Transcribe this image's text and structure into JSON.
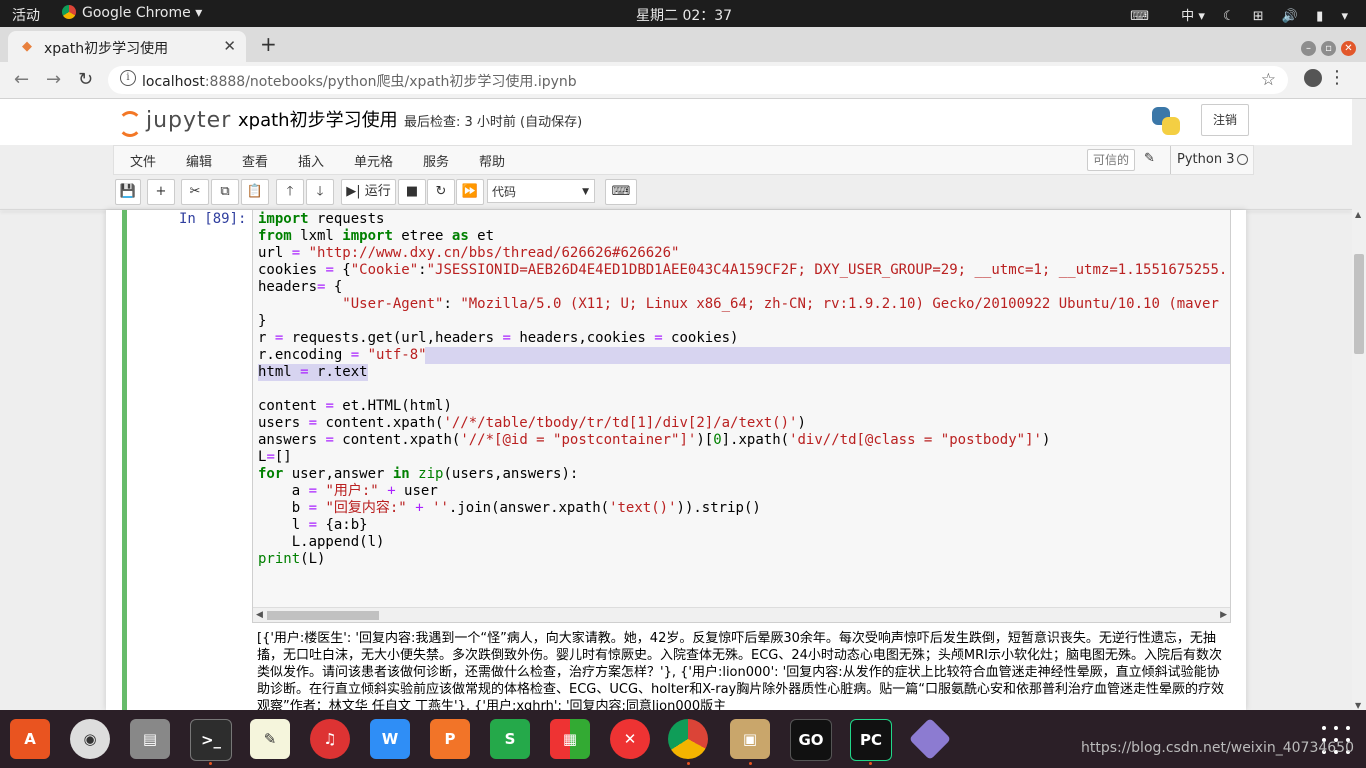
{
  "system": {
    "activities": "活动",
    "app_name": "Google Chrome",
    "clock": "星期二 02：37",
    "input_method": "中"
  },
  "browser": {
    "tab_title": "xpath初步学习使用",
    "url_host": "localhost",
    "url_rest": ":8888/notebooks/python爬虫/xpath初步学习使用.ipynb"
  },
  "jupyter": {
    "logo_text": "jupyter",
    "notebook_title": "xpath初步学习使用",
    "checkpoint": "最后检查: 3 小时前  (自动保存)",
    "logout": "注销",
    "menu": [
      "文件",
      "编辑",
      "查看",
      "插入",
      "单元格",
      "服务",
      "帮助"
    ],
    "trusted": "可信的",
    "kernel": "Python 3",
    "run_label": "运行",
    "cell_type": "代码"
  },
  "cell": {
    "prompt": "In [89]:",
    "code_lines": [
      "import requests",
      "from lxml import etree as et",
      "url = \"http://www.dxy.cn/bbs/thread/626626#626626\"",
      "cookies = {\"Cookie\":\"JSESSIONID=AEB26D4E4ED1DBD1AEE043C4A159CF2F; DXY_USER_GROUP=29; __utmc=1; __utmz=1.1551675255.",
      "headers= {",
      "          \"User-Agent\": \"Mozilla/5.0 (X11; U; Linux x86_64; zh-CN; rv:1.9.2.10) Gecko/20100922 Ubuntu/10.10 (maver",
      "}",
      "r = requests.get(url,headers = headers,cookies = cookies)",
      "r.encoding = \"utf-8\"",
      "html = r.text",
      "",
      "content = et.HTML(html)",
      "users = content.xpath('//*/table/tbody/tr/td[1]/div[2]/a/text()')",
      "answers = content.xpath('//*[@id = \"postcontainer\"]')[0].xpath('div//td[@class = \"postbody\"]')",
      "L=[]",
      "for user,answer in zip(users,answers):",
      "    a = \"用户:\" + user",
      "    b = \"回复内容:\" + ''.join(answer.xpath('text()')).strip()",
      "    l = {a:b}",
      "    L.append(l)",
      "print(L)"
    ],
    "output": "[{'用户:楼医生': '回复内容:我遇到一个“怪”病人，向大家请教。她，42岁。反复惊吓后晕厥30余年。每次受响声惊吓后发生跌倒，短暂意识丧失。无逆行性遗忘，无抽搐，无口吐白沫，无大小便失禁。多次跌倒致外伤。婴儿时有惊厥史。入院查体无殊。ECG、24小时动态心电图无殊；头颅MRI示小软化灶；脑电图无殊。入院后有数次类似发作。请问该患者该做何诊断，还需做什么检查，治疗方案怎样？'}, {'用户:lion000': '回复内容:从发作的症状上比较符合血管迷走神经性晕厥，直立倾斜试验能协助诊断。在行直立倾斜实验前应该做常规的体格检查、ECG、UCG、holter和X-ray胸片除外器质性心脏病。贴一篇“口服氨酰心安和依那普利治疗血管迷走性晕厥的疗效观察”作者：林文华 任自文 丁燕生'}, {'用户:xghrh': '回复内容:同意lion000版主"
  },
  "watermark": "https://blog.csdn.net/weixin_40734650",
  "colors": {
    "topbar": "#1d1d1d",
    "dock": "#2b1f27",
    "cell_selected": "#66bb6a",
    "jupyter_orange": "#f37726",
    "keyword": "#008000",
    "string": "#ba2121"
  }
}
